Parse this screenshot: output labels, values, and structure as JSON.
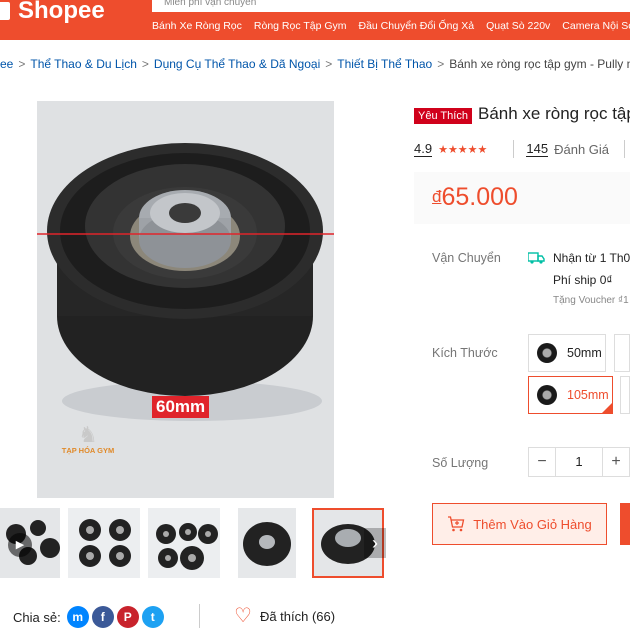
{
  "header": {
    "logo": "Shopee",
    "search_placeholder": "Miễn phí vận chuyển",
    "suggestions": [
      "Bánh Xe Ròng Rọc",
      "Ròng Rọc Tập Gym",
      "Đầu Chuyển Đổi Ống Xả",
      "Quạt Sò 220v",
      "Camera Nội Sơ"
    ]
  },
  "breadcrumb": {
    "items": [
      "ee",
      "Thể Thao & Du Lịch",
      "Dụng Cụ Thể Thao & Dã Ngoại",
      "Thiết Bị Thể Thao"
    ],
    "current": "Bánh xe ròng rọc tập gym - Pully nhôm"
  },
  "gallery": {
    "size_tag": "60mm",
    "watermark": "TẠP HÓA GYM",
    "play_icon": "play-icon",
    "next_icon": "chevron-right-icon"
  },
  "share": {
    "label": "Chia sẻ:",
    "networks": [
      {
        "name": "messenger-icon",
        "glyph": "m",
        "color": "#0084ff"
      },
      {
        "name": "facebook-icon",
        "glyph": "f",
        "color": "#3b5998"
      },
      {
        "name": "pinterest-icon",
        "glyph": "P",
        "color": "#c8232c"
      },
      {
        "name": "twitter-icon",
        "glyph": "t",
        "color": "#1da1f2"
      }
    ],
    "like_label": "Đã thích (66)"
  },
  "product": {
    "badge": "Yêu Thích",
    "title": "Bánh xe ròng rọc tập",
    "rating": "4.9",
    "stars": "★★★★★",
    "review_count": "145",
    "review_label": "Đánh Giá",
    "currency": "đ",
    "price": "65.000"
  },
  "shipping": {
    "label": "Vận Chuyển",
    "line1": "Nhận từ 1 Th0",
    "line2": "Phí ship 0₫",
    "line3": "Tặng Voucher ₫1"
  },
  "size": {
    "label": "Kích Thước",
    "options": [
      "50mm",
      "105mm"
    ],
    "selected": "105mm"
  },
  "quantity": {
    "label": "Số Lượng",
    "minus": "−",
    "value": "1",
    "plus": "+"
  },
  "actions": {
    "add_to_cart": "Thêm Vào Giỏ Hàng"
  },
  "colors": {
    "brand": "#ee4d2d",
    "badge": "#d0011b"
  }
}
